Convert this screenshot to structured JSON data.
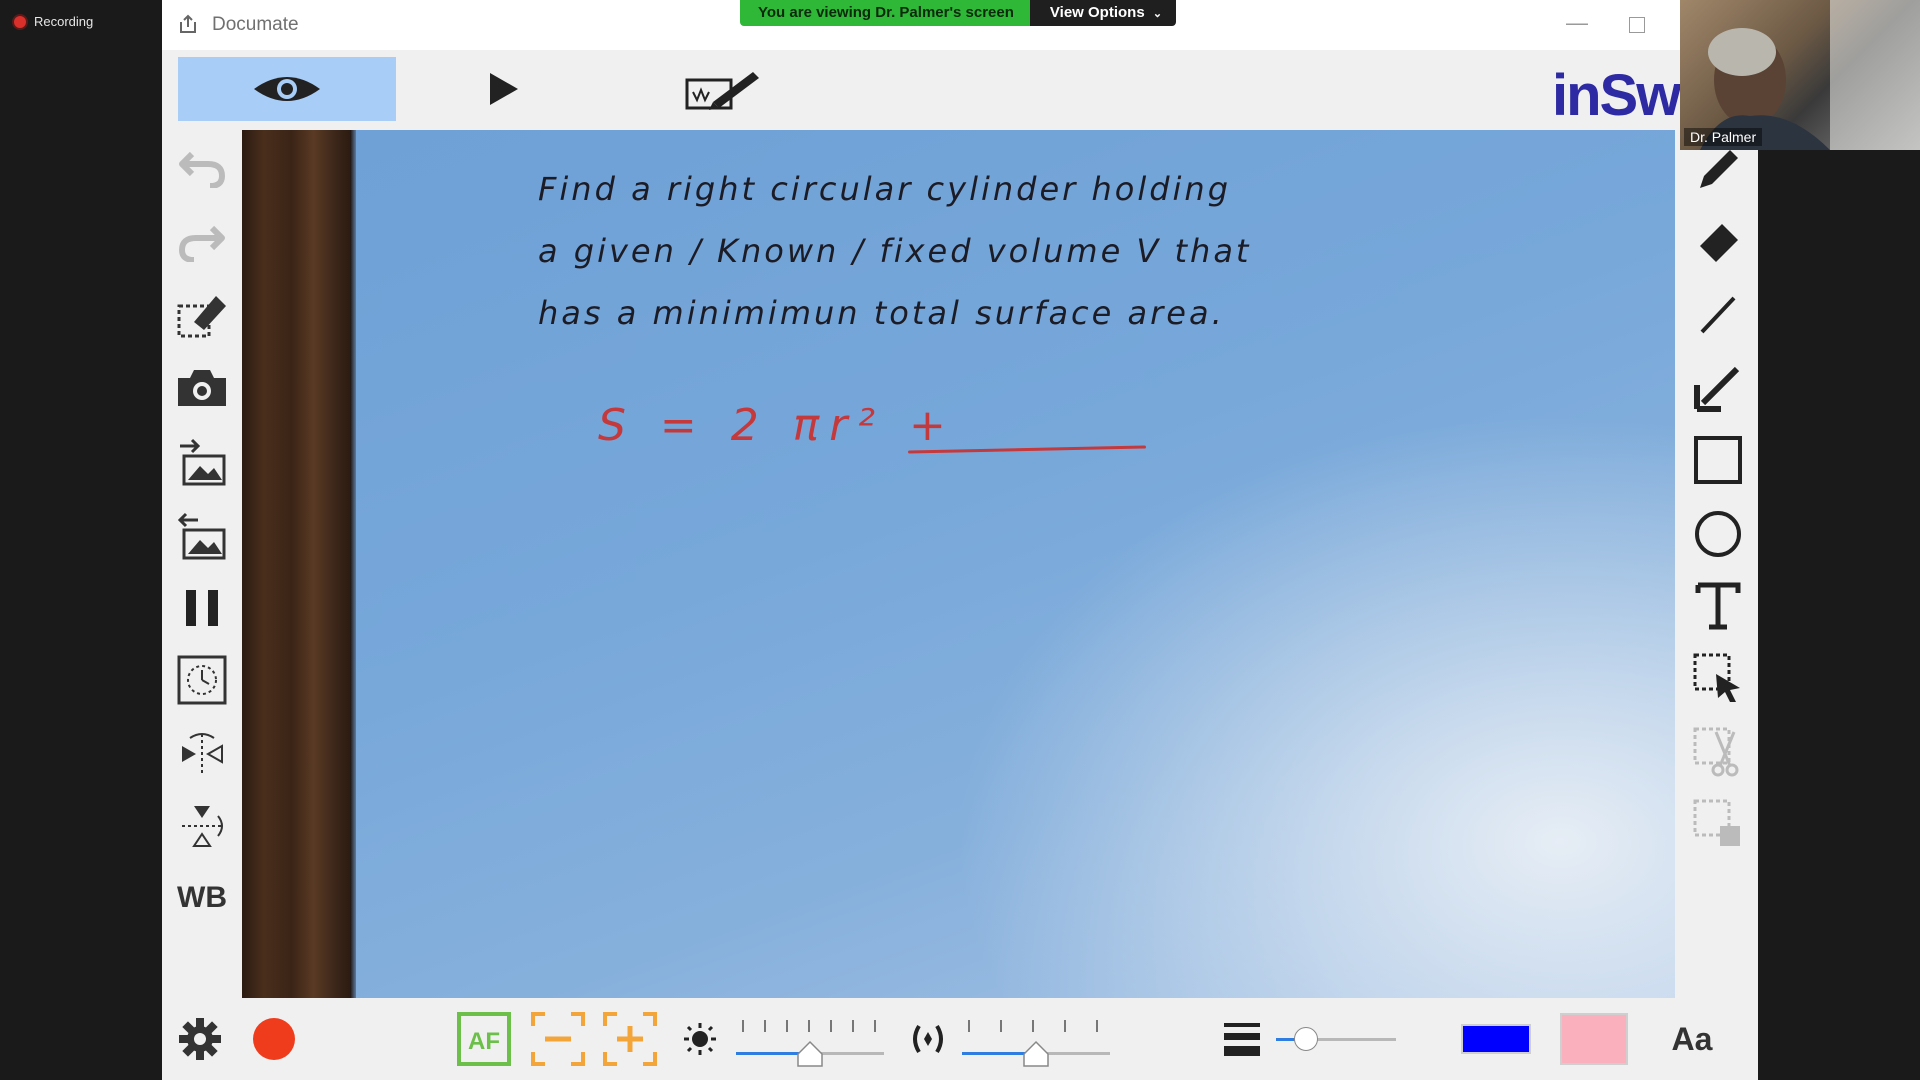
{
  "recording": {
    "label": "Recording"
  },
  "app": {
    "title": "Documate",
    "minimize_glyph": "—"
  },
  "share_banner": {
    "text": "You are viewing Dr. Palmer's screen",
    "options_label": "View Options",
    "options_icon": "chevron-down-icon"
  },
  "mode_tabs": [
    {
      "name": "view",
      "icon": "eye-icon",
      "active": true
    },
    {
      "name": "playback",
      "icon": "play-icon",
      "active": false
    },
    {
      "name": "annotate",
      "icon": "pen-annotate-icon",
      "active": false
    }
  ],
  "brand": {
    "text": "inSwo"
  },
  "left_toolbar": [
    {
      "icon": "undo-icon"
    },
    {
      "icon": "redo-icon"
    },
    {
      "icon": "clear-annotation-icon"
    },
    {
      "icon": "camera-icon"
    },
    {
      "icon": "import-image-icon"
    },
    {
      "icon": "export-image-icon"
    },
    {
      "icon": "pause-icon"
    },
    {
      "icon": "timer-icon"
    },
    {
      "icon": "flip-horizontal-icon"
    },
    {
      "icon": "flip-vertical-icon"
    },
    {
      "label": "WB"
    }
  ],
  "whiteboard": {
    "lines": [
      "Find a right circular cylinder holding",
      "a given / Known / fixed volume V that",
      "has a minimimun total surface area."
    ],
    "equation": "S = 2 πr² +"
  },
  "right_toolbar": [
    {
      "icon": "pen-icon"
    },
    {
      "icon": "eraser-icon"
    },
    {
      "icon": "line-icon"
    },
    {
      "icon": "arrow-icon"
    },
    {
      "icon": "rectangle-icon"
    },
    {
      "icon": "circle-icon"
    },
    {
      "icon": "text-icon"
    },
    {
      "icon": "select-icon"
    },
    {
      "icon": "cut-icon"
    },
    {
      "icon": "copy-icon"
    }
  ],
  "bottom_bar": {
    "af_label": "AF",
    "font_label": "Aa",
    "colors": {
      "record": "#ef3c1c",
      "accent_green": "#6cc04a",
      "accent_orange": "#f3a53a",
      "pen_color": "#0000ff",
      "fill_color": "#fbb1bd"
    },
    "brightness_level": 0.5,
    "contrast_level": 0.5,
    "line_width_level": 0.25
  },
  "participant": {
    "name": "Dr. Palmer"
  }
}
